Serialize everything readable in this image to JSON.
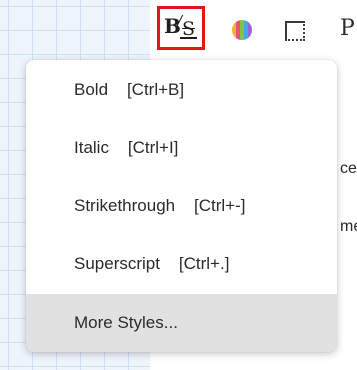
{
  "toolbar": {
    "style_icon": "bold-italic-strike-icon",
    "color_icon": "color-palette-icon",
    "border_icon": "border-icon",
    "partial_icon_glyph": "P",
    "accent_color": "#e4141b"
  },
  "peek_text": [
    "ce",
    "me"
  ],
  "menu": {
    "items": [
      {
        "label": "Bold",
        "shortcut": "[Ctrl+B]"
      },
      {
        "label": "Italic",
        "shortcut": "[Ctrl+I]"
      },
      {
        "label": "Strikethrough",
        "shortcut": "[Ctrl+-]"
      },
      {
        "label": "Superscript",
        "shortcut": "[Ctrl+.]"
      },
      {
        "label": "More Styles...",
        "shortcut": ""
      }
    ],
    "active_index": 4
  }
}
